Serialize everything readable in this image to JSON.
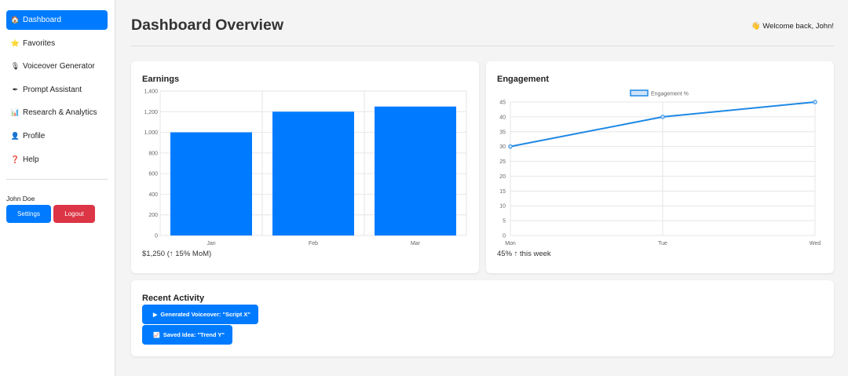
{
  "sidebar": {
    "items": [
      {
        "icon": "house-icon",
        "glyph": "🏠",
        "label": "Dashboard",
        "active": true
      },
      {
        "icon": "star-icon",
        "glyph": "⭐",
        "label": "Favorites"
      },
      {
        "icon": "microphone-icon",
        "glyph": "🎙",
        "label": "Voiceover Generator"
      },
      {
        "icon": "pen-icon",
        "glyph": "✒",
        "label": "Prompt Assistant"
      },
      {
        "icon": "bar-chart-icon",
        "glyph": "📊",
        "label": "Research & Analytics"
      },
      {
        "icon": "user-icon",
        "glyph": "👤",
        "label": "Profile"
      },
      {
        "icon": "question-icon",
        "glyph": "❓",
        "label": "Help"
      }
    ],
    "user_name": "John Doe",
    "settings_label": "Settings",
    "logout_label": "Logout"
  },
  "header": {
    "title": "Dashboard Overview",
    "welcome_icon": "waving-hand-icon",
    "welcome_glyph": "👋",
    "welcome": "Welcome back, John!"
  },
  "earnings": {
    "title": "Earnings",
    "summary": "$1,250 (↑ 15% MoM)"
  },
  "engagement": {
    "title": "Engagement",
    "summary": "45% ↑ this week"
  },
  "activity": {
    "title": "Recent Activity",
    "items": [
      {
        "icon": "play-icon",
        "glyph": "▶",
        "label": "Generated Voiceover: \"Script X\""
      },
      {
        "icon": "chart-icon",
        "glyph": "📈",
        "label": "Saved Idea: \"Trend Y\""
      }
    ]
  },
  "colors": {
    "accent": "#007bff",
    "danger": "#dc3545",
    "line": "#1e88e5"
  },
  "chart_data": [
    {
      "type": "bar",
      "categories": [
        "Jan",
        "Feb",
        "Mar"
      ],
      "values": [
        1000,
        1200,
        1250
      ],
      "ylim": [
        0,
        1400
      ],
      "yticks": [
        0,
        200,
        400,
        600,
        800,
        1000,
        1200,
        1400
      ],
      "ytick_labels": [
        "0",
        "200",
        "400",
        "600",
        "800",
        "1,000",
        "1,200",
        "1,400"
      ],
      "grid": true
    },
    {
      "type": "line",
      "categories": [
        "Mon",
        "Tue",
        "Wed"
      ],
      "series": [
        {
          "name": "Engagement %",
          "values": [
            30,
            40,
            45
          ]
        }
      ],
      "ylim": [
        0,
        45
      ],
      "yticks": [
        0,
        5,
        10,
        15,
        20,
        25,
        30,
        35,
        40,
        45
      ],
      "legend": "top-center",
      "grid": true
    }
  ]
}
